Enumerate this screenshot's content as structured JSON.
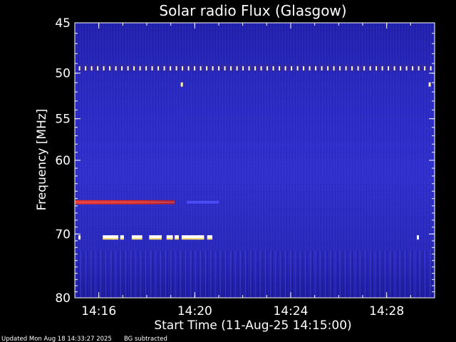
{
  "chart_data": {
    "type": "heatmap",
    "title": "Solar radio Flux (Glasgow)",
    "xlabel": "Start Time (11-Aug-25 14:15:00)",
    "ylabel": "Frequency [MHz]",
    "x_unit": "minutes",
    "x_range": [
      "14:15:00",
      "14:30:00"
    ],
    "x_ticks": [
      "14:16",
      "14:20",
      "14:24",
      "14:28"
    ],
    "y_ticks": [
      "45",
      "50",
      "55",
      "60",
      "70",
      "80"
    ],
    "y_scale": "log",
    "ylim": [
      45,
      80
    ],
    "colormap": [
      "#1a1a90",
      "#2c2cc8",
      "#3a3ae6",
      "#cc2020",
      "#ffffff"
    ],
    "features": [
      {
        "name": "periodic interference",
        "freq_mhz": 49.5,
        "times": [
          "14:15:10",
          "14:29:50"
        ],
        "intensity": "high"
      },
      {
        "name": "isolated spike",
        "freq_mhz": 51.2,
        "times": [
          "14:19:25"
        ],
        "intensity": "high"
      },
      {
        "name": "isolated spike",
        "freq_mhz": 51.2,
        "times": [
          "14:29:45"
        ],
        "intensity": "high"
      },
      {
        "name": "strong band",
        "freq_mhz": 65.5,
        "times": [
          "14:15:00",
          "14:19:10"
        ],
        "intensity": "medium"
      },
      {
        "name": "weak band",
        "freq_mhz": 65.5,
        "times": [
          "14:19:40",
          "14:21:00"
        ],
        "intensity": "low"
      },
      {
        "name": "burst segments",
        "freq_mhz": 70.5,
        "times": [
          "14:16:10",
          "14:21:00"
        ],
        "intensity": "high"
      }
    ]
  },
  "footer": {
    "updated": "Updated Mon Aug 18 14:33:27 2025",
    "note": "BG subtracted"
  }
}
